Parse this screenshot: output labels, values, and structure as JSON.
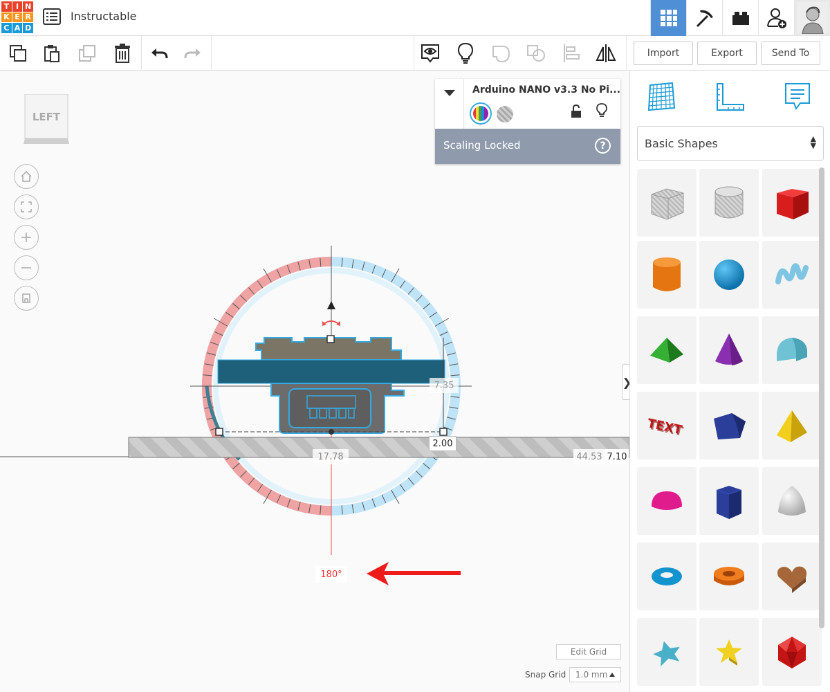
{
  "app": {
    "logo_letters": [
      "T",
      "I",
      "N",
      "K",
      "E",
      "R",
      "C",
      "A",
      "D"
    ],
    "logo_colors": [
      "#e8432a",
      "#e8432a",
      "#e8432a",
      "#f7941d",
      "#f7941d",
      "#f7941d",
      "#1a9bd7",
      "#1a9bd7",
      "#1a9bd7"
    ],
    "title": "Instructable"
  },
  "toolbar": {
    "import_label": "Import",
    "export_label": "Export",
    "sendto_label": "Send To"
  },
  "viewcube": {
    "face": "LEFT"
  },
  "properties": {
    "name": "Arduino NANO v3.3 No Pi...",
    "scaling_status": "Scaling Locked",
    "help": "?"
  },
  "dimensions": {
    "height": "7.35",
    "elevation": "2.00",
    "width": "17.78",
    "depth": "44.53",
    "extra": "7.10",
    "rotation": "180°"
  },
  "grid_controls": {
    "edit_grid_label": "Edit Grid",
    "snap_label": "Snap Grid",
    "snap_value": "1.0 mm"
  },
  "panel": {
    "category": "Basic Shapes",
    "shapes": [
      "box-hole",
      "cylinder-hole",
      "box",
      "cylinder",
      "sphere",
      "scribble",
      "roof",
      "cone",
      "round-roof",
      "text",
      "polygon",
      "pyramid",
      "half-sphere",
      "prism",
      "paraboloid",
      "torus",
      "tube",
      "heart",
      "star-flat",
      "star",
      "icosahedron"
    ]
  },
  "colors": {
    "accent": "#4f8fd6",
    "selection": "#36a9e1",
    "board": "#1e5f7a",
    "rotate_red": "#e85050",
    "rotate_blue": "#bfe3f7"
  }
}
